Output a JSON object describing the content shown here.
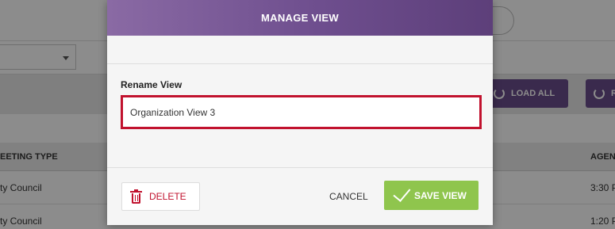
{
  "background": {
    "toolbar": {
      "load_all_label": "LOAD ALL",
      "refresh_label": "R"
    },
    "table": {
      "headers": [
        "EETING TYPE",
        "AGEN"
      ],
      "rows": [
        {
          "meeting_type": "ty Council",
          "time": "3:30 P"
        },
        {
          "meeting_type": "ty Council",
          "time": "1:20 P"
        }
      ]
    }
  },
  "modal": {
    "title": "MANAGE VIEW",
    "rename_label": "Rename View",
    "rename_value": "Organization View 3",
    "delete_label": "DELETE",
    "cancel_label": "CANCEL",
    "save_label": "SAVE VIEW"
  },
  "colors": {
    "header_gradient_start": "#8a6aa4",
    "header_gradient_end": "#5d3f7a",
    "danger": "#c1122e",
    "save_green": "#8fc54d"
  }
}
